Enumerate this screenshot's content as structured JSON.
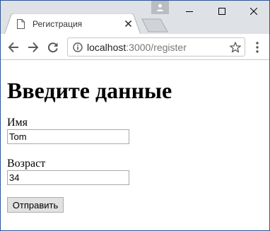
{
  "browser": {
    "tab": {
      "title": "Регистрация"
    },
    "address_bar": {
      "host": "localhost",
      "path": ":3000/register"
    }
  },
  "page": {
    "heading": "Введите данные",
    "form": {
      "name_label": "Имя",
      "name_value": "Tom",
      "age_label": "Возраст",
      "age_value": "34",
      "submit_label": "Отправить"
    }
  },
  "colors": {
    "titlebar": "#dee1e6",
    "window_border": "#2b5797",
    "url_path": "#777777"
  }
}
